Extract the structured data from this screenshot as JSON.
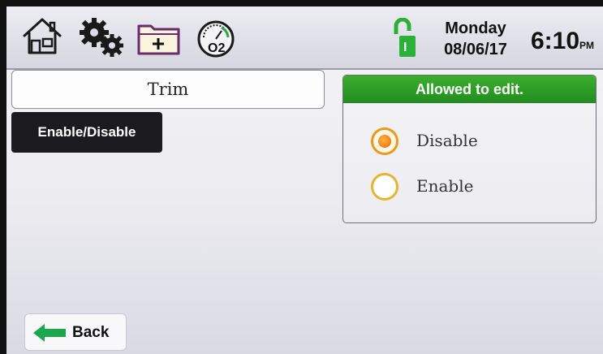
{
  "toolbar": {
    "home": "home-icon",
    "settings": "gears-icon",
    "add_folder": "folder-add-icon",
    "oxygen_sensor": "o2-gauge-icon",
    "oxygen_label": "O2"
  },
  "status": {
    "lock_icon": "unlocked-padlock-icon",
    "lock_letter": "I",
    "day": "Monday",
    "date": "08/06/17",
    "time": "6:10",
    "ampm": "PM"
  },
  "main": {
    "title": "Trim",
    "section_button": "Enable/Disable"
  },
  "options": {
    "header": "Allowed to edit.",
    "items": [
      {
        "label": "Disable",
        "selected": true
      },
      {
        "label": "Enable",
        "selected": false
      }
    ]
  },
  "back": {
    "label": "Back",
    "icon": "left-arrow-icon"
  },
  "colors": {
    "header_green": "#2b9a25",
    "radio_orange": "#f07f10",
    "radio_ring": "#e8b42e",
    "lock_green": "#2bb03a",
    "back_arrow_green": "#1aa94a"
  }
}
